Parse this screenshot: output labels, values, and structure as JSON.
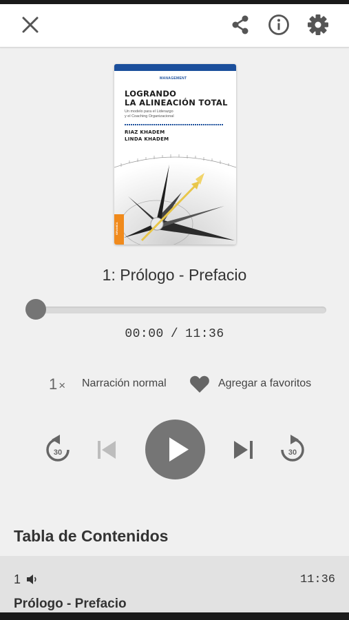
{
  "header": {
    "close_icon": "close-icon",
    "share_icon": "share-icon",
    "info_icon": "info-icon",
    "settings_icon": "gear-icon"
  },
  "cover": {
    "brand": "MANAGEMENT",
    "title_line1": "LOGRANDO",
    "title_line2": "LA ALINEACIÓN TOTAL",
    "subtitle_line1": "Un modelo para el Liderazgo",
    "subtitle_line2": "y el Coaching Organizacional",
    "author1": "RIAZ KHADEM",
    "author2": "LINDA KHADEM",
    "publisher": "GRANICA"
  },
  "player": {
    "track_title": "1: Prólogo - Prefacio",
    "progress_fraction": 0,
    "time_elapsed": "00:00",
    "time_separator": "/",
    "time_total": "11:36",
    "speed_value": "1",
    "speed_suffix": "×",
    "narration_label": "Narración normal",
    "favorites_label": "Agregar a favoritos",
    "rewind_seconds": "30",
    "forward_seconds": "30"
  },
  "toc": {
    "heading": "Tabla de Contenidos",
    "items": [
      {
        "number": "1",
        "duration": "11:36",
        "title": "Prólogo - Prefacio"
      }
    ]
  },
  "colors": {
    "accent": "#757575",
    "cover_blue": "#1b4f9c",
    "cover_orange": "#f08a1c",
    "arrow_gold": "#e8c64a"
  }
}
